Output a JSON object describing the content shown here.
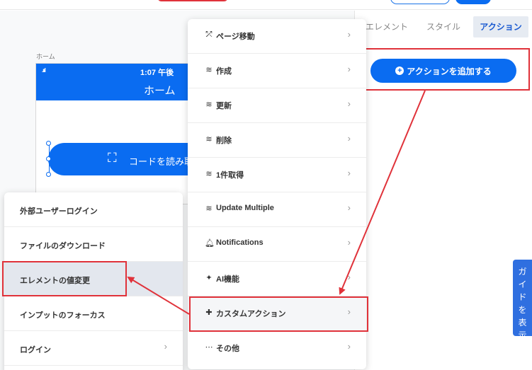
{
  "tabs": [
    {
      "label": "エレメント"
    },
    {
      "label": "スタイル"
    },
    {
      "label": "アクション"
    }
  ],
  "add_action_label": "アクションを追加する",
  "canvas": {
    "screen_label": "ホーム",
    "status_signal": ".ııl",
    "status_time": "1:07 午後",
    "phone_title": "ホーム",
    "qr_button_label": "コードを読み取"
  },
  "menu": {
    "items": [
      {
        "icon": "route-icon",
        "glyph": "⤱",
        "label": "ページ移動"
      },
      {
        "icon": "database-icon",
        "glyph": "≋",
        "label": "作成"
      },
      {
        "icon": "database-icon",
        "glyph": "≋",
        "label": "更新"
      },
      {
        "icon": "database-icon",
        "glyph": "≋",
        "label": "削除"
      },
      {
        "icon": "database-icon",
        "glyph": "≋",
        "label": "1件取得"
      },
      {
        "icon": "database-icon",
        "glyph": "≋",
        "label": "Update Multiple"
      },
      {
        "icon": "bell-icon",
        "glyph": "🔔︎",
        "label": "Notifications"
      },
      {
        "icon": "magic-wand-icon",
        "glyph": "✦",
        "label": "AI機能"
      },
      {
        "icon": "puzzle-icon",
        "glyph": "✚",
        "label": "カスタムアクション"
      },
      {
        "icon": "ellipsis-icon",
        "glyph": "⋯",
        "label": "その他"
      }
    ],
    "chevron": "›"
  },
  "submenu": {
    "items": [
      {
        "label": "外部ユーザーログイン"
      },
      {
        "label": "ファイルのダウンロード"
      },
      {
        "label": "エレメントの値変更"
      },
      {
        "label": "インプットのフォーカス"
      },
      {
        "label": "ログイン"
      }
    ],
    "chevron": "›"
  },
  "guide_tab_label": "ガイドを表示",
  "colors": {
    "accent": "#0a6cf1",
    "annotation_red": "#e0323a",
    "active_tab_bg": "#e6ebf2",
    "guide_tab": "#2f6fe0"
  }
}
